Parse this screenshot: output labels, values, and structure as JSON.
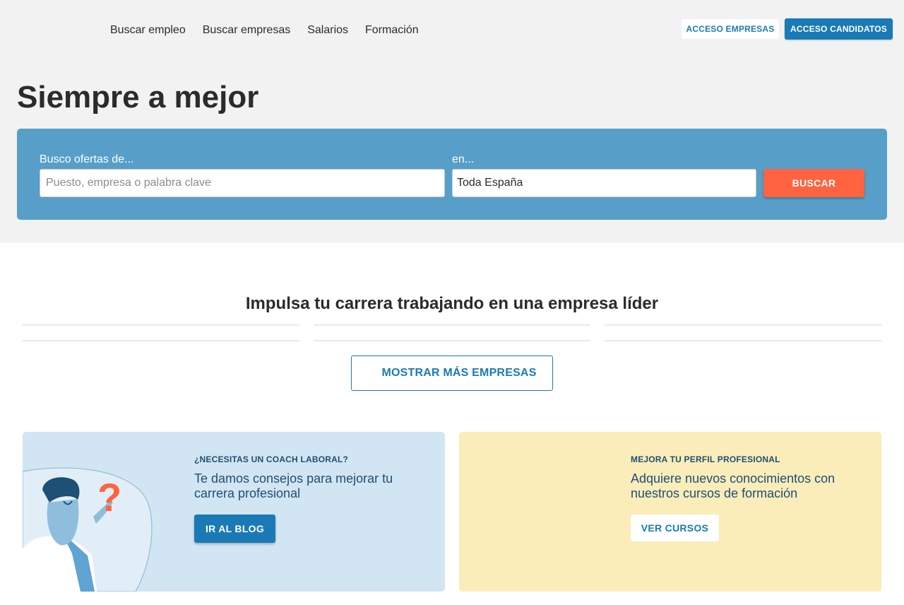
{
  "nav": {
    "items": [
      "Buscar empleo",
      "Buscar empresas",
      "Salarios",
      "Formación"
    ]
  },
  "header": {
    "access_companies": "ACCESO EMPRESAS",
    "access_candidates": "ACCESO CANDIDATOS"
  },
  "hero": {
    "title": "Siempre a mejor"
  },
  "search": {
    "what_label": "Busco ofertas de...",
    "what_placeholder": "Puesto, empresa o palabra clave",
    "what_value": "",
    "where_label": "en...",
    "where_value": "Toda España",
    "button": "BUSCAR"
  },
  "companies": {
    "title": "Impulsa tu carrera trabajando en una empresa líder",
    "show_more": "MOSTRAR MÁS EMPRESAS"
  },
  "cards": {
    "coach": {
      "kicker": "¿NECESITAS UN COACH LABORAL?",
      "text": "Te damos consejos para mejorar tu carrera profesional",
      "button": "IR AL BLOG"
    },
    "courses": {
      "kicker": "MEJORA TU PERFIL PROFESIONAL",
      "text": "Adquiere nuevos conocimientos con nuestros cursos de formación",
      "button": "VER CURSOS"
    }
  },
  "colors": {
    "brand_blue": "#1a7ab5",
    "search_panel": "#579fc9",
    "search_button": "#ff6340",
    "coach_card": "#d2e5f2",
    "courses_card": "#faedb9"
  },
  "icons": {
    "coach_illustration": "person-question-illustration"
  }
}
